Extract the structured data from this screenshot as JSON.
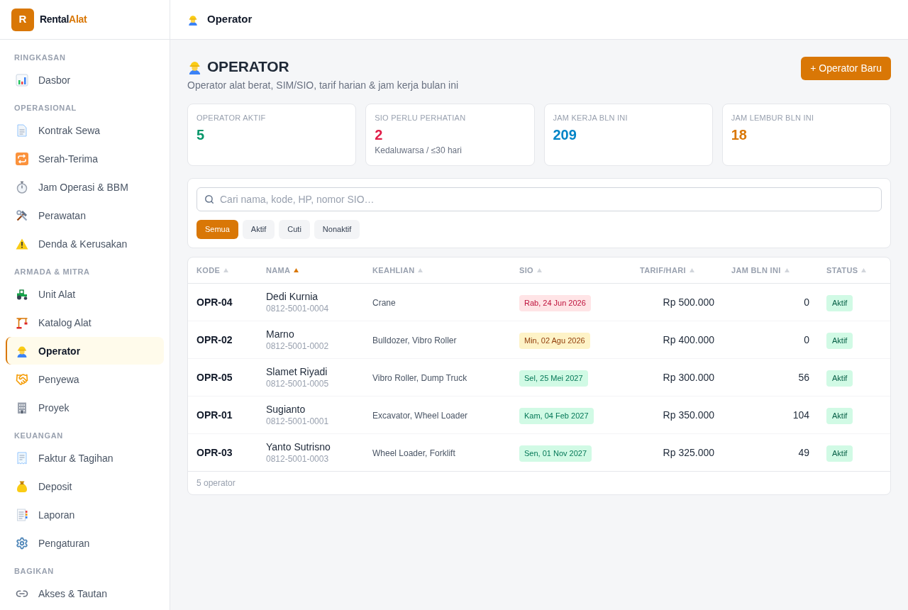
{
  "brand": {
    "logo_letter": "R",
    "name": "Rental",
    "name_accent": "Alat"
  },
  "sidebar": {
    "sections": [
      {
        "title": "RINGKASAN",
        "items": [
          {
            "label": "Dasbor",
            "selected": false
          }
        ]
      },
      {
        "title": "OPERASIONAL",
        "items": [
          {
            "label": "Kontrak Sewa",
            "selected": false
          },
          {
            "label": "Serah-Terima",
            "selected": false
          },
          {
            "label": "Jam Operasi & BBM",
            "selected": false
          },
          {
            "label": "Perawatan",
            "selected": false
          },
          {
            "label": "Denda & Kerusakan",
            "selected": false
          }
        ]
      },
      {
        "title": "ARMADA & MITRA",
        "items": [
          {
            "label": "Unit Alat",
            "selected": false
          },
          {
            "label": "Katalog Alat",
            "selected": false
          },
          {
            "label": "Operator",
            "selected": true
          },
          {
            "label": "Penyewa",
            "selected": false
          },
          {
            "label": "Proyek",
            "selected": false
          }
        ]
      },
      {
        "title": "KEUANGAN",
        "items": [
          {
            "label": "Faktur & Tagihan",
            "selected": false
          },
          {
            "label": "Deposit",
            "selected": false
          },
          {
            "label": "Laporan",
            "selected": false
          },
          {
            "label": "Pengaturan",
            "selected": false
          }
        ]
      },
      {
        "title": "BAGIKAN",
        "items": [
          {
            "label": "Akses & Tautan",
            "selected": false
          }
        ]
      }
    ]
  },
  "topbar": {
    "title": "Operator"
  },
  "page": {
    "title": "OPERATOR",
    "subtitle": "Operator alat berat, SIM/SIO, tarif harian & jam kerja bulan ini",
    "new_button": "+ Operator Baru"
  },
  "stats": [
    {
      "label": "OPERATOR AKTIF",
      "value": "5",
      "color": "#059669"
    },
    {
      "label": "SIO PERLU PERHATIAN",
      "value": "2",
      "note": "Kedaluwarsa / ≤30 hari",
      "color": "#e11d48"
    },
    {
      "label": "JAM KERJA BLN INI",
      "value": "209",
      "color": "#0284c7"
    },
    {
      "label": "JAM LEMBUR BLN INI",
      "value": "18",
      "color": "#d97706"
    }
  ],
  "search": {
    "placeholder": "Cari nama, kode, HP, nomor SIO…"
  },
  "filters": [
    {
      "label": "Semua",
      "selected": true
    },
    {
      "label": "Aktif",
      "selected": false
    },
    {
      "label": "Cuti",
      "selected": false
    },
    {
      "label": "Nonaktif",
      "selected": false
    }
  ],
  "table": {
    "columns": [
      {
        "label": "KODE",
        "sorted": false
      },
      {
        "label": "NAMA",
        "sorted": true
      },
      {
        "label": "KEAHLIAN",
        "sorted": false
      },
      {
        "label": "SIO",
        "sorted": false
      },
      {
        "label": "TARIF/HARI",
        "sorted": false
      },
      {
        "label": "JAM BLN INI",
        "sorted": false
      },
      {
        "label": "STATUS",
        "sorted": false
      }
    ],
    "rows": [
      {
        "code": "OPR-04",
        "name": "Dedi Kurnia",
        "phone": "0812-5001-0004",
        "skills": "Crane",
        "sio": {
          "date": "Rab, 24 Jun 2026",
          "expired": true,
          "expiring_soon": false
        },
        "rate": "Rp 500.000",
        "hours": "0",
        "status": "Aktif"
      },
      {
        "code": "OPR-02",
        "name": "Marno",
        "phone": "0812-5001-0002",
        "skills": "Bulldozer, Vibro Roller",
        "sio": {
          "date": "Min, 02 Agu 2026",
          "expired": false,
          "expiring_soon": true
        },
        "rate": "Rp 400.000",
        "hours": "0",
        "status": "Aktif"
      },
      {
        "code": "OPR-05",
        "name": "Slamet Riyadi",
        "phone": "0812-5001-0005",
        "skills": "Vibro Roller, Dump Truck",
        "sio": {
          "date": "Sel, 25 Mei 2027",
          "expired": false,
          "expiring_soon": false
        },
        "rate": "Rp 300.000",
        "hours": "56",
        "status": "Aktif"
      },
      {
        "code": "OPR-01",
        "name": "Sugianto",
        "phone": "0812-5001-0001",
        "skills": "Excavator, Wheel Loader",
        "sio": {
          "date": "Kam, 04 Feb 2027",
          "expired": false,
          "expiring_soon": false
        },
        "rate": "Rp 350.000",
        "hours": "104",
        "status": "Aktif"
      },
      {
        "code": "OPR-03",
        "name": "Yanto Sutrisno",
        "phone": "0812-5001-0003",
        "skills": "Wheel Loader, Forklift",
        "sio": {
          "date": "Sen, 01 Nov 2027",
          "expired": false,
          "expiring_soon": false
        },
        "rate": "Rp 325.000",
        "hours": "49",
        "status": "Aktif"
      }
    ],
    "footer": "5 operator"
  }
}
